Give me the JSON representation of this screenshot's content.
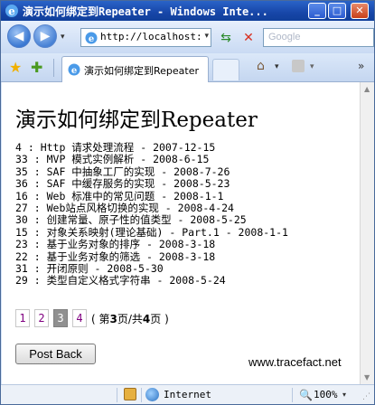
{
  "window": {
    "title": "演示如何绑定到Repeater - Windows Inte...",
    "minimize_label": "_",
    "maximize_label": "□",
    "close_label": "✕"
  },
  "navbar": {
    "back_glyph": "◀",
    "forward_glyph": "▶",
    "address_value": "http://localhost:1",
    "dropdown_glyph": "▾",
    "refresh_glyph": "⇆",
    "stop_glyph": "✕",
    "search_placeholder": "Google"
  },
  "tabbar": {
    "tab_label": "演示如何绑定到Repeater",
    "favorites_glyph": "★",
    "add_favorite_glyph": "✚",
    "home_glyph": "⌂",
    "chevron_glyph": "»",
    "dropdown_glyph": "▾"
  },
  "page": {
    "title": "演示如何绑定到Repeater",
    "articles": [
      "4 : Http 请求处理流程 - 2007-12-15",
      "33 : MVP 模式实例解析 - 2008-6-15",
      "35 : SAF 中抽象工厂的实现 - 2008-7-26",
      "36 : SAF 中缓存服务的实现 - 2008-5-23",
      "16 : Web 标准中的常见问题 - 2008-1-1",
      "27 : Web站点风格切换的实现 - 2008-4-24",
      "30 : 创建常量、原子性的值类型 - 2008-5-25",
      "15 : 对象关系映射(理论基础) - Part.1 - 2008-1-1",
      "23 : 基于业务对象的排序 - 2008-3-18",
      "22 : 基于业务对象的筛选 - 2008-3-18",
      "31 : 开闭原则 - 2008-5-30",
      "29 : 类型自定义格式字符串 - 2008-5-24"
    ],
    "pager": {
      "pages": [
        "1",
        "2",
        "3",
        "4"
      ],
      "current_page": 3,
      "info_prefix": "( 第",
      "info_current": "3",
      "info_mid": "页/共",
      "info_total": "4",
      "info_suffix": "页 )"
    },
    "postback_label": "Post Back",
    "site_label": "www.tracefact.net"
  },
  "statusbar": {
    "zone_label": "Internet",
    "zoom_label": "100%",
    "zoom_glyph": "🔍",
    "dropdown_glyph": "▾"
  },
  "colors": {
    "titlebar": "#1746a8",
    "visited_link": "#800080",
    "current_page_bg": "#909090"
  }
}
